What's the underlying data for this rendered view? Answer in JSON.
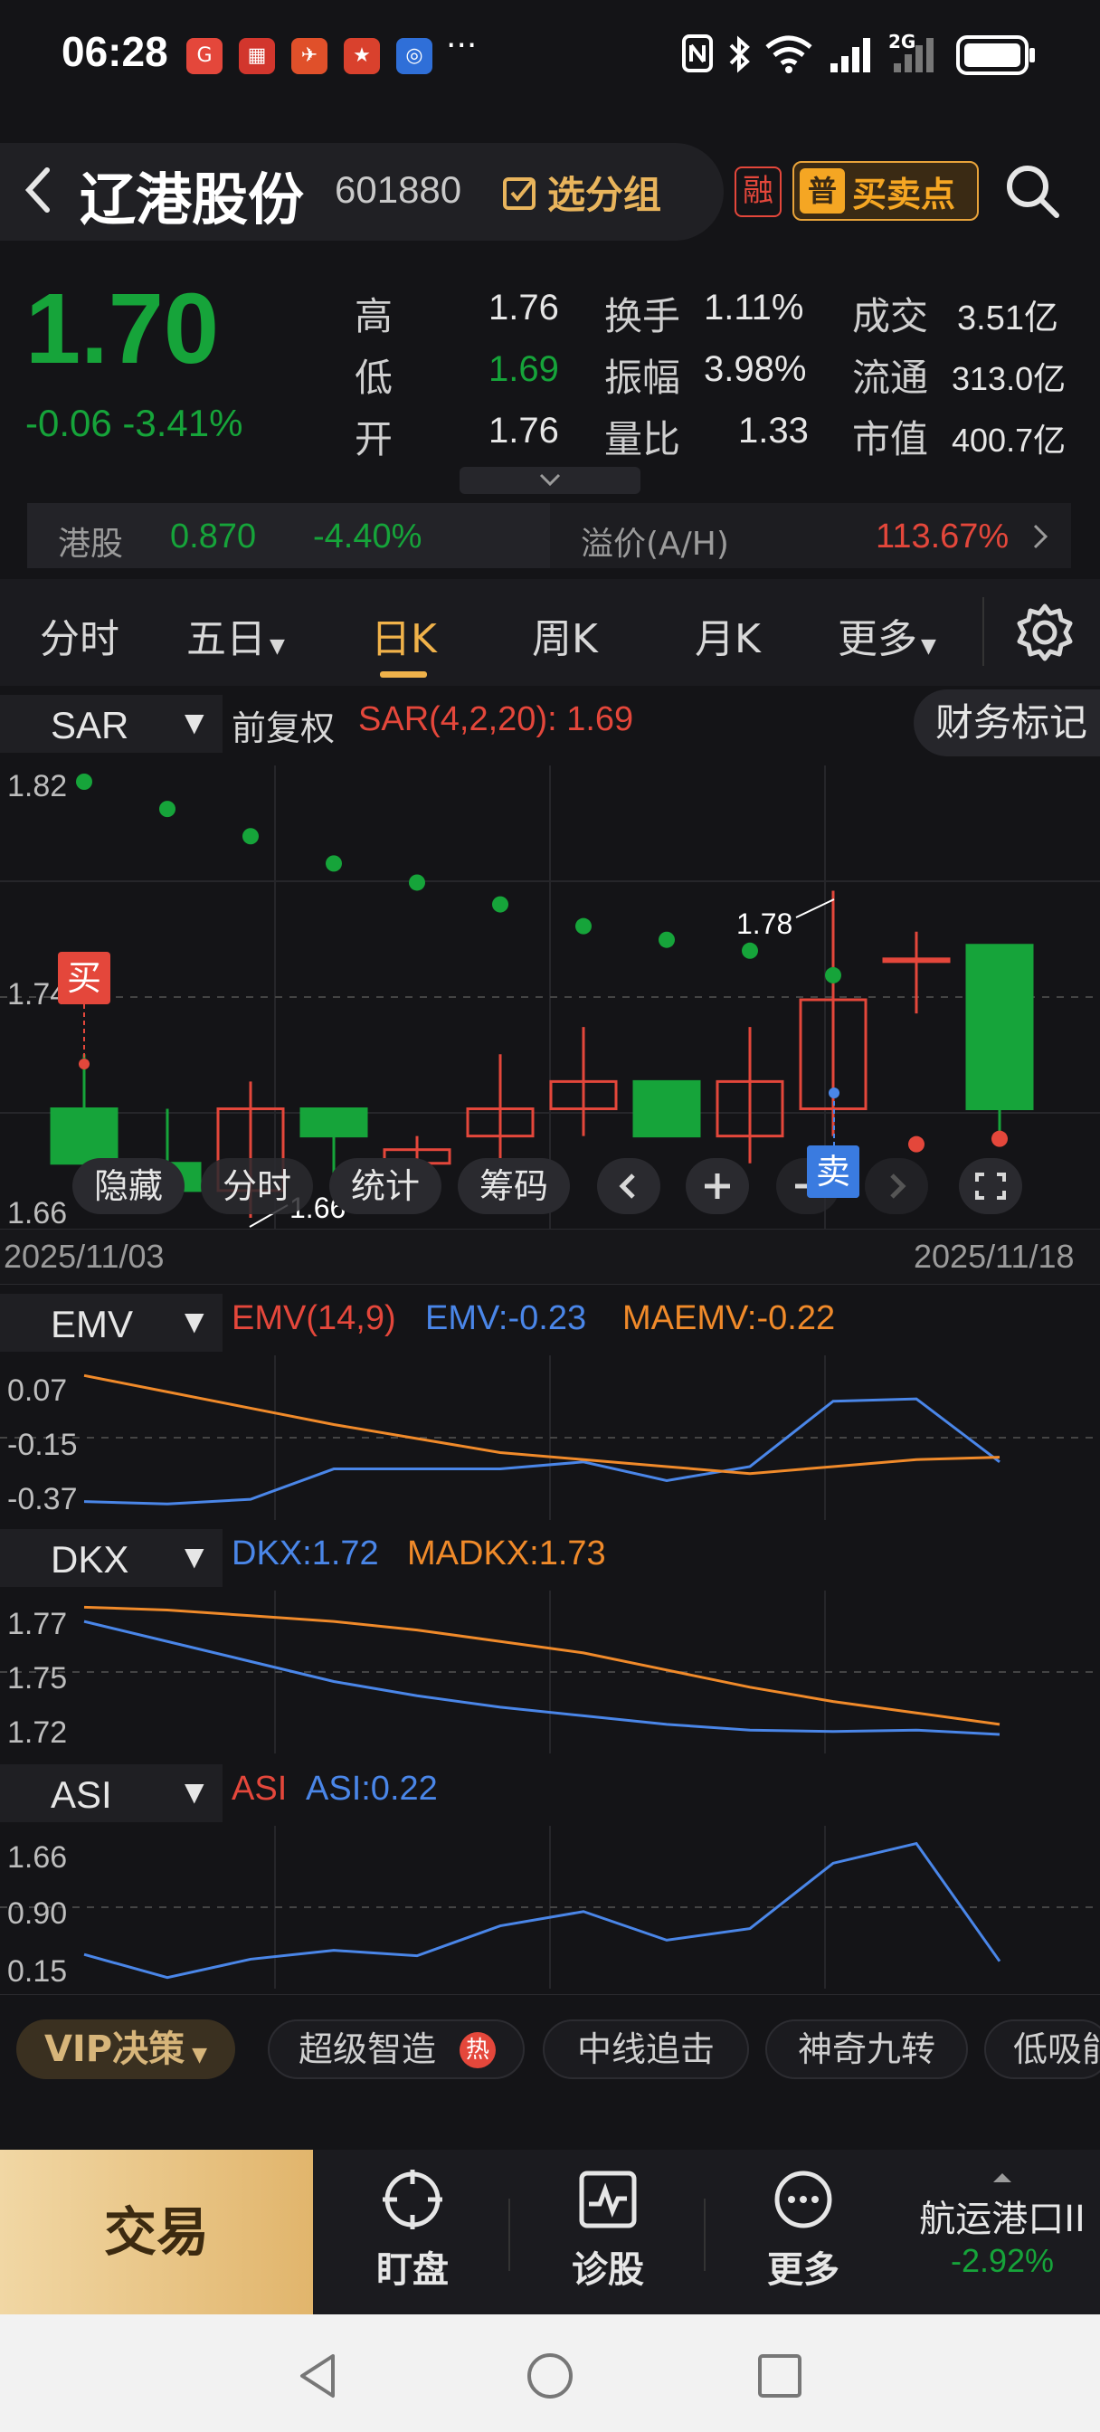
{
  "status_bar": {
    "time": "06:28",
    "more": "···",
    "signal_label": "2G"
  },
  "header": {
    "stock_name": "辽港股份",
    "stock_code": "601880",
    "group_label": "选分组",
    "rong_label": "融",
    "buysell_label": "买卖点",
    "buysell_badge": "普"
  },
  "quote": {
    "price": "1.70",
    "change": "-0.06  -3.41%",
    "rows": [
      {
        "l1": "高",
        "v1": "1.76",
        "l2": "换手",
        "v2": "1.11%",
        "l3": "成交",
        "v3": "3.51亿"
      },
      {
        "l1": "低",
        "v1": "1.69",
        "l2": "振幅",
        "v2": "3.98%",
        "l3": "流通",
        "v3": "313.0亿"
      },
      {
        "l1": "开",
        "v1": "1.76",
        "l2": "量比",
        "v2": "1.33",
        "l3": "市值",
        "v3": "400.7亿"
      }
    ],
    "hk_label": "港股",
    "hk_price": "0.870",
    "hk_change": "-4.40%",
    "premium_label": "溢价(A/H)",
    "premium_value": "113.67%"
  },
  "tabs": [
    {
      "label": "分时",
      "active": false
    },
    {
      "label": "五日",
      "active": false
    },
    {
      "label": "日K",
      "active": true
    },
    {
      "label": "周K",
      "active": false
    },
    {
      "label": "月K",
      "active": false
    },
    {
      "label": "更多",
      "active": false
    }
  ],
  "main_chart": {
    "indicator": "SAR",
    "adjust": "前复权",
    "legend": "SAR(4,2,20):  1.69",
    "financial_btn": "财务标记",
    "y_top": "1.82",
    "y_mid": "1.74",
    "y_bottom": "1.66",
    "high_label": "1.78",
    "low_label": "1.66",
    "buy_label": "买",
    "sell_label": "卖",
    "date_start": "2025/11/03",
    "date_end": "2025/11/18",
    "tools": [
      "隐藏",
      "分时",
      "统计",
      "筹码"
    ]
  },
  "chart_data": {
    "type": "candlestick",
    "ylim": [
      1.66,
      1.82
    ],
    "candles": [
      {
        "o": 1.7,
        "c": 1.68,
        "h": 1.72,
        "l": 1.68
      },
      {
        "o": 1.68,
        "c": 1.67,
        "h": 1.7,
        "l": 1.665
      },
      {
        "o": 1.67,
        "c": 1.7,
        "h": 1.71,
        "l": 1.66
      },
      {
        "o": 1.7,
        "c": 1.69,
        "h": 1.7,
        "l": 1.67
      },
      {
        "o": 1.68,
        "c": 1.685,
        "h": 1.69,
        "l": 1.675
      },
      {
        "o": 1.69,
        "c": 1.7,
        "h": 1.72,
        "l": 1.68
      },
      {
        "o": 1.7,
        "c": 1.71,
        "h": 1.73,
        "l": 1.69
      },
      {
        "o": 1.71,
        "c": 1.69,
        "h": 1.71,
        "l": 1.69
      },
      {
        "o": 1.69,
        "c": 1.71,
        "h": 1.73,
        "l": 1.68
      },
      {
        "o": 1.7,
        "c": 1.74,
        "h": 1.78,
        "l": 1.69
      },
      {
        "o": 1.755,
        "c": 1.755,
        "h": 1.765,
        "l": 1.735
      },
      {
        "o": 1.76,
        "c": 1.7,
        "h": 1.76,
        "l": 1.69
      }
    ],
    "sar": [
      1.82,
      1.81,
      1.8,
      1.79,
      1.783,
      1.775,
      1.767,
      1.762,
      1.758,
      1.749,
      1.687,
      1.689
    ],
    "sar_colors": [
      "g",
      "g",
      "g",
      "g",
      "g",
      "g",
      "g",
      "g",
      "g",
      "g",
      "r",
      "r"
    ]
  },
  "emv_panel": {
    "indicator": "EMV",
    "legend_name": "EMV(14,9)",
    "legend_emv": "EMV:-0.23",
    "legend_maemv": "MAEMV:-0.22",
    "y_labels": [
      "0.07",
      "-0.15",
      "-0.37"
    ],
    "emv": [
      -0.4,
      -0.41,
      -0.39,
      -0.26,
      -0.26,
      -0.26,
      -0.23,
      -0.31,
      -0.25,
      0.03,
      0.04,
      -0.23
    ],
    "maemv": [
      0.14,
      0.07,
      0.0,
      -0.07,
      -0.13,
      -0.19,
      -0.22,
      -0.25,
      -0.28,
      -0.25,
      -0.22,
      -0.21
    ]
  },
  "dkx_panel": {
    "indicator": "DKX",
    "legend_dkx": "DKX:1.72",
    "legend_madkx": "MADKX:1.73",
    "y_labels": [
      "1.77",
      "1.75",
      "1.72"
    ],
    "dkx": [
      1.774,
      1.767,
      1.76,
      1.753,
      1.748,
      1.744,
      1.741,
      1.738,
      1.736,
      1.7355,
      1.736,
      1.7345
    ],
    "madkx": [
      1.779,
      1.778,
      1.776,
      1.774,
      1.771,
      1.767,
      1.763,
      1.757,
      1.751,
      1.746,
      1.742,
      1.738
    ]
  },
  "asi_panel": {
    "indicator": "ASI",
    "legend_name": "ASI",
    "legend_asi": "ASI:0.22",
    "y_labels": [
      "1.66",
      "0.90",
      "0.15"
    ],
    "asi": [
      0.32,
      -0.02,
      0.25,
      0.38,
      0.3,
      0.74,
      0.95,
      0.53,
      0.7,
      1.66,
      1.95,
      0.22
    ]
  },
  "strategy": {
    "vip": "VIP决策",
    "chips": [
      "超级智造",
      "中线追击",
      "神奇九转",
      "低吸能"
    ],
    "hot": "热"
  },
  "bottom_nav": {
    "trade": "交易",
    "items": [
      "盯盘",
      "诊股",
      "更多"
    ],
    "sector_name": "航运港口II",
    "sector_change": "-2.92%"
  },
  "colors": {
    "up": "#e4473b",
    "down": "#16a43a",
    "accent": "#f0b24a",
    "blue": "#4a86e8",
    "orange": "#f08a2a"
  }
}
